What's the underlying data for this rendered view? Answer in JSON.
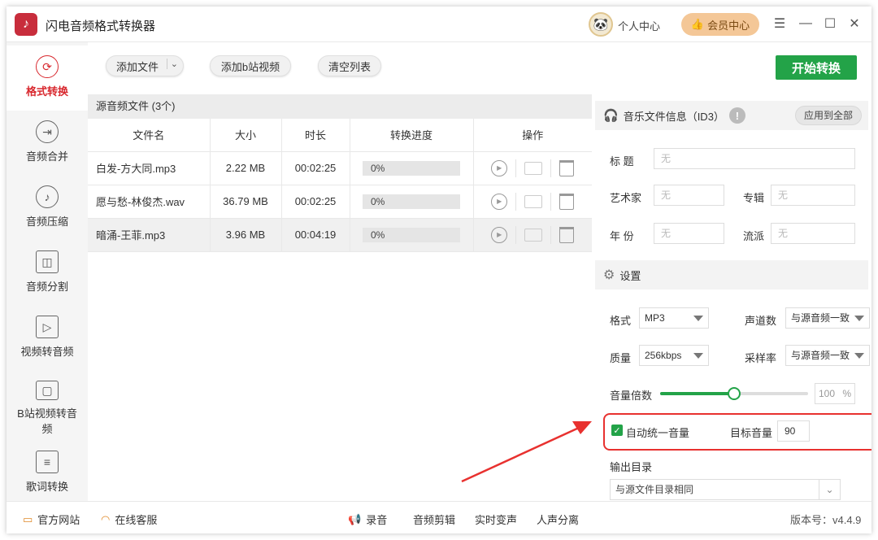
{
  "titlebar": {
    "app_title": "闪电音频格式转换器",
    "user_center": "个人中心",
    "member_center": "会员中心"
  },
  "sidebar": {
    "items": [
      {
        "label": "格式转换",
        "icon": "refresh-icon"
      },
      {
        "label": "音频合并",
        "icon": "merge-icon"
      },
      {
        "label": "音频压缩",
        "icon": "music-note-icon"
      },
      {
        "label": "音频分割",
        "icon": "split-icon"
      },
      {
        "label": "视频转音频",
        "icon": "video-audio-icon"
      },
      {
        "label": "B站视频转音频",
        "icon": "bilibili-icon"
      },
      {
        "label": "歌词转换",
        "icon": "lyrics-icon"
      }
    ]
  },
  "toolbar": {
    "add_file": "添加文件",
    "add_bilibili": "添加b站视频",
    "clear_list": "清空列表",
    "start_convert": "开始转换"
  },
  "filelist": {
    "header": "源音频文件 (3个)",
    "columns": [
      "文件名",
      "大小",
      "时长",
      "转换进度",
      "操作"
    ],
    "rows": [
      {
        "name": "白发-方大同.mp3",
        "size": "2.22 MB",
        "duration": "00:02:25",
        "progress": "0%"
      },
      {
        "name": "愿与愁-林俊杰.wav",
        "size": "36.79 MB",
        "duration": "00:02:25",
        "progress": "0%"
      },
      {
        "name": "暗涌-王菲.mp3",
        "size": "3.96 MB",
        "duration": "00:04:19",
        "progress": "0%"
      }
    ]
  },
  "id3": {
    "header": "音乐文件信息（ID3）",
    "apply_all": "应用到全部",
    "title_label": "标  题",
    "artist_label": "艺术家",
    "album_label": "专辑",
    "year_label": "年  份",
    "genre_label": "流派",
    "placeholder": "无"
  },
  "settings": {
    "header": "设置",
    "format_label": "格式",
    "format_value": "MP3",
    "channels_label": "声道数",
    "channels_value": "与源音频一致",
    "quality_label": "质量",
    "quality_value": "256kbps",
    "samplerate_label": "采样率",
    "samplerate_value": "与源音频一致",
    "volume_label": "音量倍数",
    "volume_value": "100",
    "volume_unit": "%",
    "volume_fraction": 0.5,
    "auto_volume_label": "自动统一音量",
    "auto_volume_checked": true,
    "target_volume_label": "目标音量",
    "target_volume_value": "90",
    "output_dir_label": "输出目录",
    "output_dir_value": "与源文件目录相同"
  },
  "bottombar": {
    "official_site": "官方网站",
    "online_service": "在线客服",
    "record": "录音",
    "audio_edit": "音频剪辑",
    "realtime_voice": "实时变声",
    "vocal_separate": "人声分离",
    "version": "版本号：v4.4.9"
  },
  "colors": {
    "accent_green": "#23a348",
    "accent_red": "#d8282e",
    "highlight_red": "#e8312f"
  }
}
